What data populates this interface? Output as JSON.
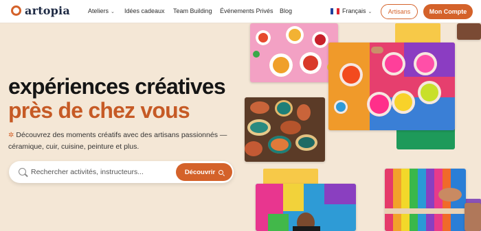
{
  "nav": {
    "logo_text": "artopia",
    "links": [
      "Ateliers",
      "Idées cadeaux",
      "Team Building",
      "Événements Privés",
      "Blog"
    ],
    "language": "Français",
    "artisans_label": "Artisans",
    "account_label": "Mon Compte"
  },
  "hero": {
    "title_line1": "expériences créatives",
    "title_line2": "près de chez vous",
    "subtitle": "Découvrez des moments créatifs avec des artisans passionnés — céramique, cuir, cuisine, peinture et plus."
  },
  "search": {
    "placeholder": "Rechercher activités, instructeurs...",
    "button_label": "Découvrir"
  },
  "colors": {
    "accent": "#d4622a",
    "background": "#f4e7d6",
    "navy": "#1e2a44"
  }
}
